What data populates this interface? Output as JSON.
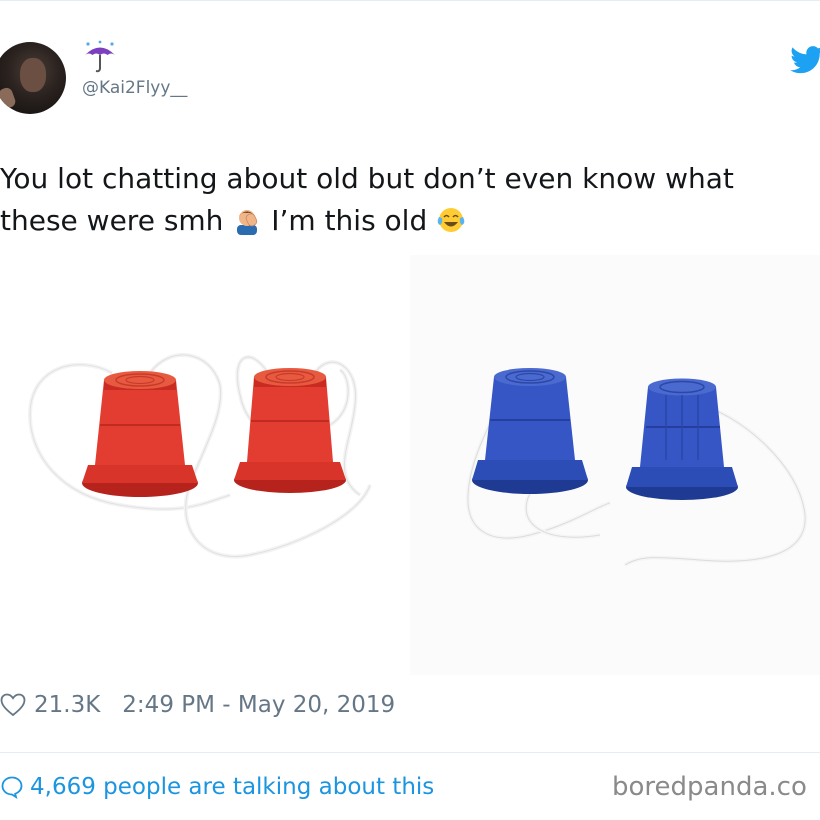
{
  "tweet": {
    "handle": "@Kai2Flyy__",
    "text_line1": "You lot chatting about old but don’t even know what",
    "text_line2a": "these were smh ",
    "text_line2b": " I’m this old ",
    "emoji_1": "man-facepalming-icon",
    "emoji_2": "face-with-tears-of-joy-icon",
    "name_emoji": "umbrella-with-rain-icon"
  },
  "photo": {
    "description_left": "red-stilt-cups",
    "description_right": "blue-stilt-cups"
  },
  "meta": {
    "likes": "21.3K",
    "timestamp": "2:49 PM - May 20, 2019"
  },
  "footer": {
    "talking": "4,669 people are talking about this",
    "watermark": "boredpanda.co"
  },
  "colors": {
    "twitter_blue": "#1da1f2",
    "link_blue": "#1b95e0",
    "muted_gray": "#657786",
    "red_cup": "#d8342a",
    "blue_cup": "#2b4db5"
  }
}
